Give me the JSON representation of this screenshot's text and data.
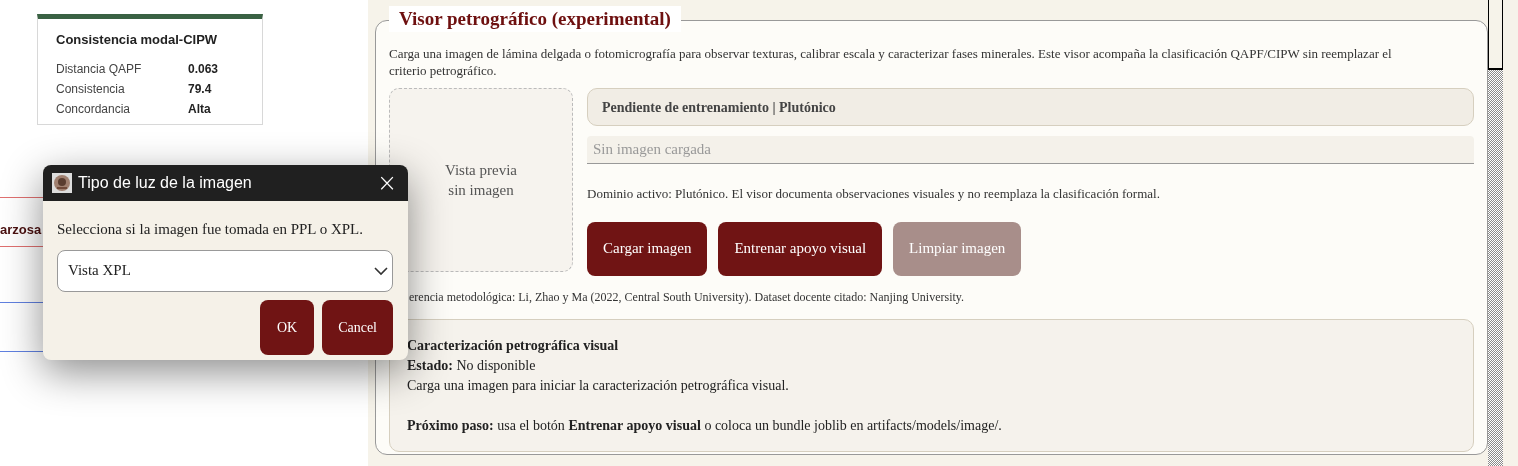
{
  "summary_card": {
    "title": "Consistencia modal-CIPW",
    "rows": [
      {
        "label": "Distancia QAPF",
        "value": "0.063"
      },
      {
        "label": "Consistencia",
        "value": "79.4"
      },
      {
        "label": "Concordancia",
        "value": "Alta"
      }
    ]
  },
  "background_fragment": "arzosa",
  "panel": {
    "title": "Visor petrográfico (experimental)",
    "description": "Carga una imagen de lámina delgada o fotomicrografía para observar texturas, calibrar escala y caracterizar fases minerales. Este visor acompaña la clasificación QAPF/CIPW sin reemplazar el criterio petrográfico.",
    "preview": [
      "Vista previa",
      "sin imagen"
    ],
    "status": "Pendiente de entrenamiento | Plutónico",
    "image_field": {
      "placeholder": "Sin imagen cargada"
    },
    "domain_note": "Dominio activo: Plutónico. El visor documenta observaciones visuales y no reemplaza la clasificación formal.",
    "buttons": [
      {
        "label": "Cargar imagen",
        "disabled": false
      },
      {
        "label": "Entrenar apoyo visual",
        "disabled": false
      },
      {
        "label": "Limpiar imagen",
        "disabled": true
      }
    ],
    "reference": "erencia metodológica: Li, Zhao y Ma (2022, Central South University). Dataset docente citado: Nanjing University.",
    "result": {
      "title": "Caracterización petrográfica visual",
      "lines": [
        "**Estado:** No disponible",
        "Carga una imagen para iniciar la caracterización petrográfica visual."
      ],
      "next_step": "**Próximo paso:** usa el botón **Entrenar apoyo visual** o coloca un bundle joblib en artifacts/models/image/."
    }
  },
  "dialog": {
    "title": "Tipo de luz de la imagen",
    "close": "×",
    "prompt": "Selecciona si la imagen fue tomada en PPL o XPL.",
    "select": {
      "value": "Vista XPL"
    },
    "buttons": [
      "OK",
      "Cancel"
    ]
  }
}
